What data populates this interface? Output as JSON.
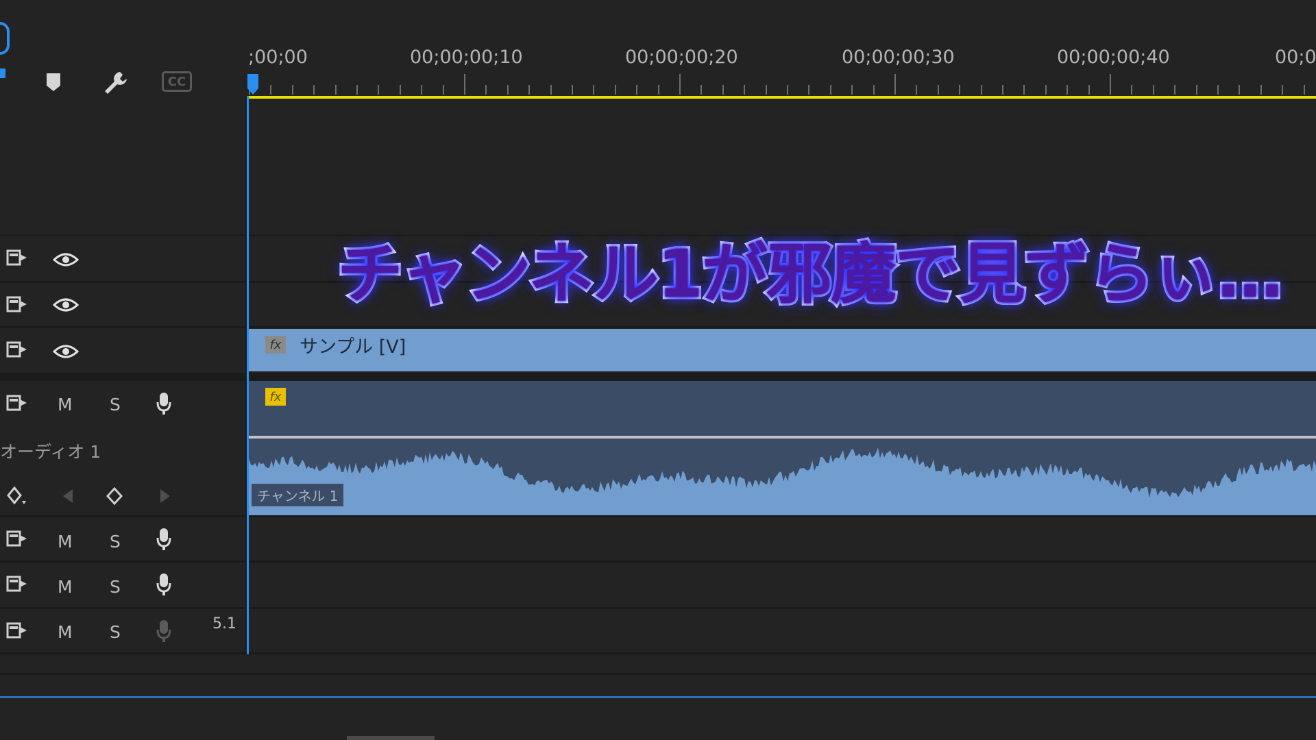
{
  "ruler": {
    "timecodes": [
      ";00;00",
      "00;00;00;10",
      "00;00;00;20",
      "00;00;00;30",
      "00;00;00;40",
      "00;0"
    ]
  },
  "toolbar": {
    "marker_icon": "marker-icon",
    "wrench_icon": "wrench-icon",
    "cc_label": "CC"
  },
  "tracks": {
    "video": [
      {
        "eye": "eye-icon"
      },
      {
        "eye": "eye-icon"
      },
      {
        "eye": "eye-icon"
      }
    ],
    "audio": [
      {
        "m": "M",
        "s": "S",
        "name": "オーディオ 1"
      },
      {
        "m": "M",
        "s": "S"
      },
      {
        "m": "M",
        "s": "S"
      },
      {
        "m": "M",
        "s": "S",
        "extra": "5.1"
      }
    ]
  },
  "clips": {
    "video_clip": {
      "fx": "fx",
      "label": "サンプル [V]"
    },
    "audio_clip": {
      "fx": "fx",
      "channel_label": "チャンネル 1"
    }
  },
  "overlay": {
    "caption": "チャンネル1が邪魔で見ずらぃ…"
  },
  "colors": {
    "playhead": "#2a8ef0",
    "work_area": "#e8e000",
    "video_clip": "#729dcf",
    "audio_clip_top": "#3b4c66",
    "waveform": "#729dcf"
  }
}
